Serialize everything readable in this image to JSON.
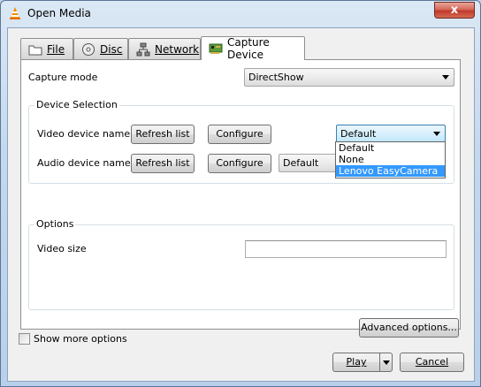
{
  "window": {
    "title": "Open Media",
    "close_symbol": "x",
    "accent_close": "#c0392b"
  },
  "tabs": [
    {
      "label": "File",
      "icon": "folder-icon"
    },
    {
      "label": "Disc",
      "icon": "disc-icon"
    },
    {
      "label": "Network",
      "icon": "network-icon"
    },
    {
      "label": "Capture Device",
      "icon": "capture-card-icon",
      "active": true
    }
  ],
  "capture": {
    "mode_label": "Capture mode",
    "mode_value": "DirectShow"
  },
  "device_selection": {
    "group_title": "Device Selection",
    "video_label": "Video device name",
    "audio_label": "Audio device name",
    "refresh_label": "Refresh list",
    "configure_label": "Configure",
    "video_value": "Default",
    "audio_value": "Default",
    "video_options": [
      "Default",
      "None",
      "Lenovo EasyCamera"
    ],
    "video_highlighted": "Lenovo EasyCamera"
  },
  "options": {
    "group_title": "Options",
    "video_size_label": "Video size",
    "video_size_value": "",
    "advanced_label": "Advanced options..."
  },
  "footer": {
    "show_more_label": "Show more options",
    "show_more_checked": false,
    "play_label": "Play",
    "cancel_label": "Cancel"
  }
}
